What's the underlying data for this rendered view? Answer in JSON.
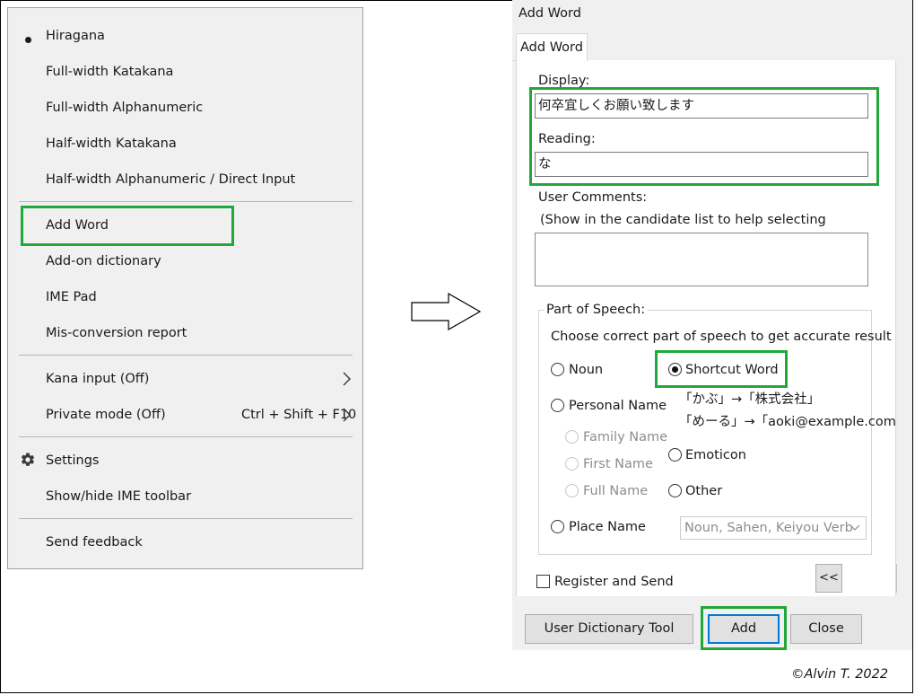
{
  "ime_menu": {
    "bullet_item_index": 0,
    "items": [
      {
        "label": "Hiragana"
      },
      {
        "label": "Full-width Katakana"
      },
      {
        "label": "Full-width Alphanumeric"
      },
      {
        "label": "Half-width Katakana"
      },
      {
        "label": "Half-width Alphanumeric / Direct Input"
      },
      {
        "label": "Add Word",
        "highlighted": true
      },
      {
        "label": "Add-on dictionary"
      },
      {
        "label": "IME Pad"
      },
      {
        "label": "Mis-conversion report"
      },
      {
        "label": "Kana input (Off)",
        "icon": "chevron-right-icon"
      },
      {
        "label": "Private mode (Off)",
        "shortcut": "Ctrl + Shift + F10",
        "icon": "chevron-right-icon"
      },
      {
        "label": "Settings",
        "icon": "gear-icon"
      },
      {
        "label": "Show/hide IME toolbar"
      },
      {
        "label": "Send feedback"
      }
    ]
  },
  "arrow": {
    "icon": "arrow-right-icon"
  },
  "add_word": {
    "window_title": "Add Word",
    "tab_label": "Add Word",
    "display_label": "Display:",
    "display_value": "何卒宜しくお願い致します",
    "reading_label": "Reading:",
    "reading_value": "な",
    "comments_label": "User Comments:",
    "comments_hint": "(Show in the candidate list to help selecting",
    "comments_value": "",
    "pos": {
      "legend": "Part of Speech:",
      "instruction": "Choose correct part of speech to get accurate result",
      "noun": "Noun",
      "shortcut_word": "Shortcut Word",
      "personal_name": "Personal Name",
      "shortcut_example_1": "「かぶ」→「株式会社」",
      "shortcut_example_2": "「めーる」→「aoki@example.com",
      "family_name": "Family Name",
      "first_name": "First Name",
      "full_name": "Full Name",
      "emoticon": "Emoticon",
      "other": "Other",
      "place_name": "Place Name",
      "select_value": "Noun, Sahen, Keiyou Verb",
      "selected": "Shortcut Word"
    },
    "register_and_send": "Register and Send",
    "register_checked": false,
    "collapse_label": "<<",
    "buttons": {
      "user_dictionary_tool": "User Dictionary Tool",
      "add": "Add",
      "close": "Close"
    }
  },
  "copyright": "©Alvin T. 2022",
  "colors": {
    "highlight": "#22a83a",
    "focus": "#0078d7",
    "menu_bg": "#f0f0f0"
  }
}
